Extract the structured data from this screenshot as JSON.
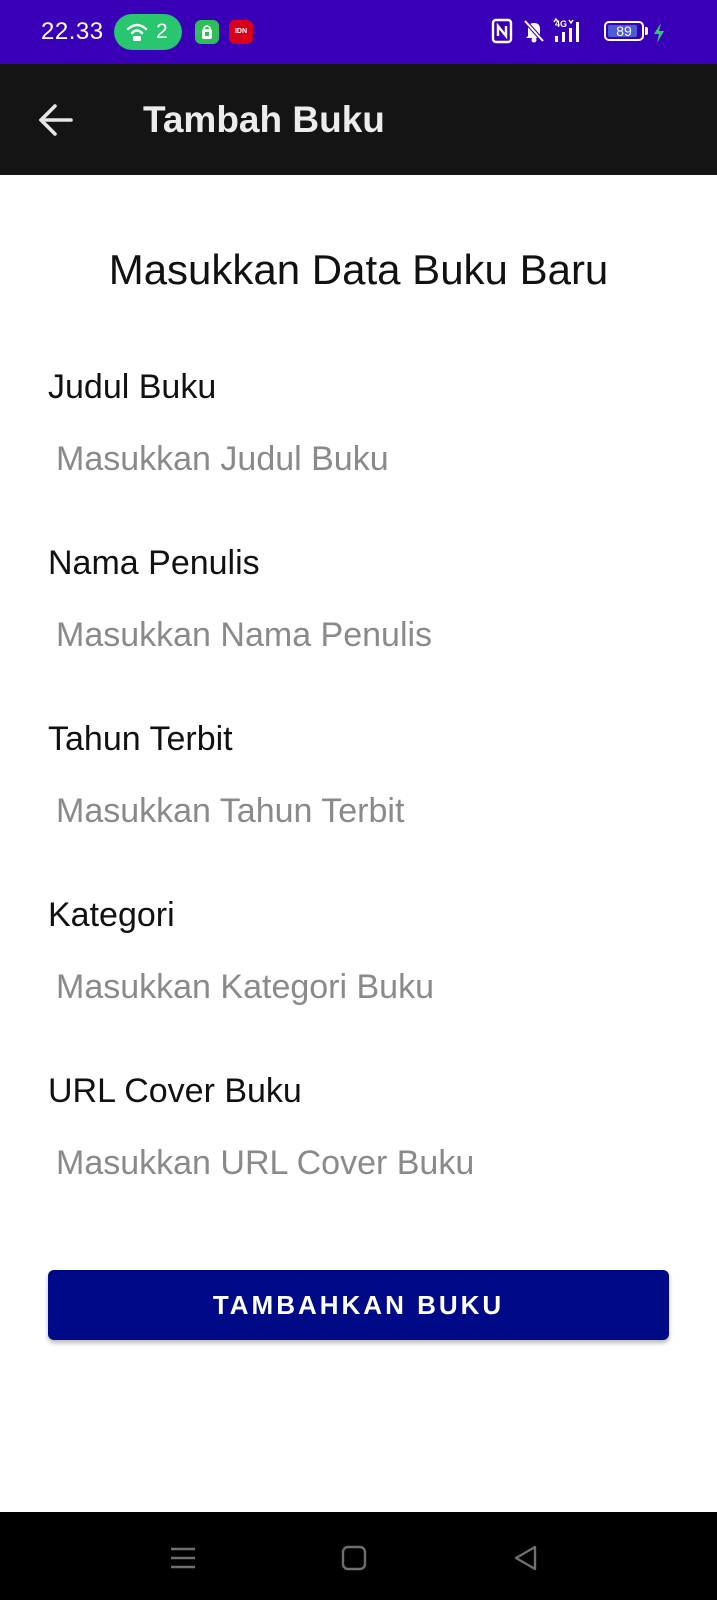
{
  "status_bar": {
    "time": "22.33",
    "hotspot_count": "2",
    "battery_level": "89",
    "color": "#3a00b7"
  },
  "app_bar": {
    "title": "Tambah Buku",
    "back_icon": "arrow-left-icon"
  },
  "form": {
    "heading": "Masukkan Data Buku Baru",
    "fields": [
      {
        "label": "Judul Buku",
        "value": "",
        "placeholder": "Masukkan Judul Buku"
      },
      {
        "label": "Nama Penulis",
        "value": "",
        "placeholder": "Masukkan Nama Penulis"
      },
      {
        "label": "Tahun Terbit",
        "value": "",
        "placeholder": "Masukkan Tahun Terbit"
      },
      {
        "label": "Kategori",
        "value": "",
        "placeholder": "Masukkan Kategori Buku"
      },
      {
        "label": "URL Cover Buku",
        "value": "",
        "placeholder": "Masukkan URL Cover Buku"
      }
    ],
    "submit_label": "TAMBAHKAN BUKU",
    "submit_color": "#010a86"
  },
  "nav_bar": {
    "icons": [
      "menu-icon",
      "home-square-icon",
      "back-triangle-icon"
    ]
  }
}
